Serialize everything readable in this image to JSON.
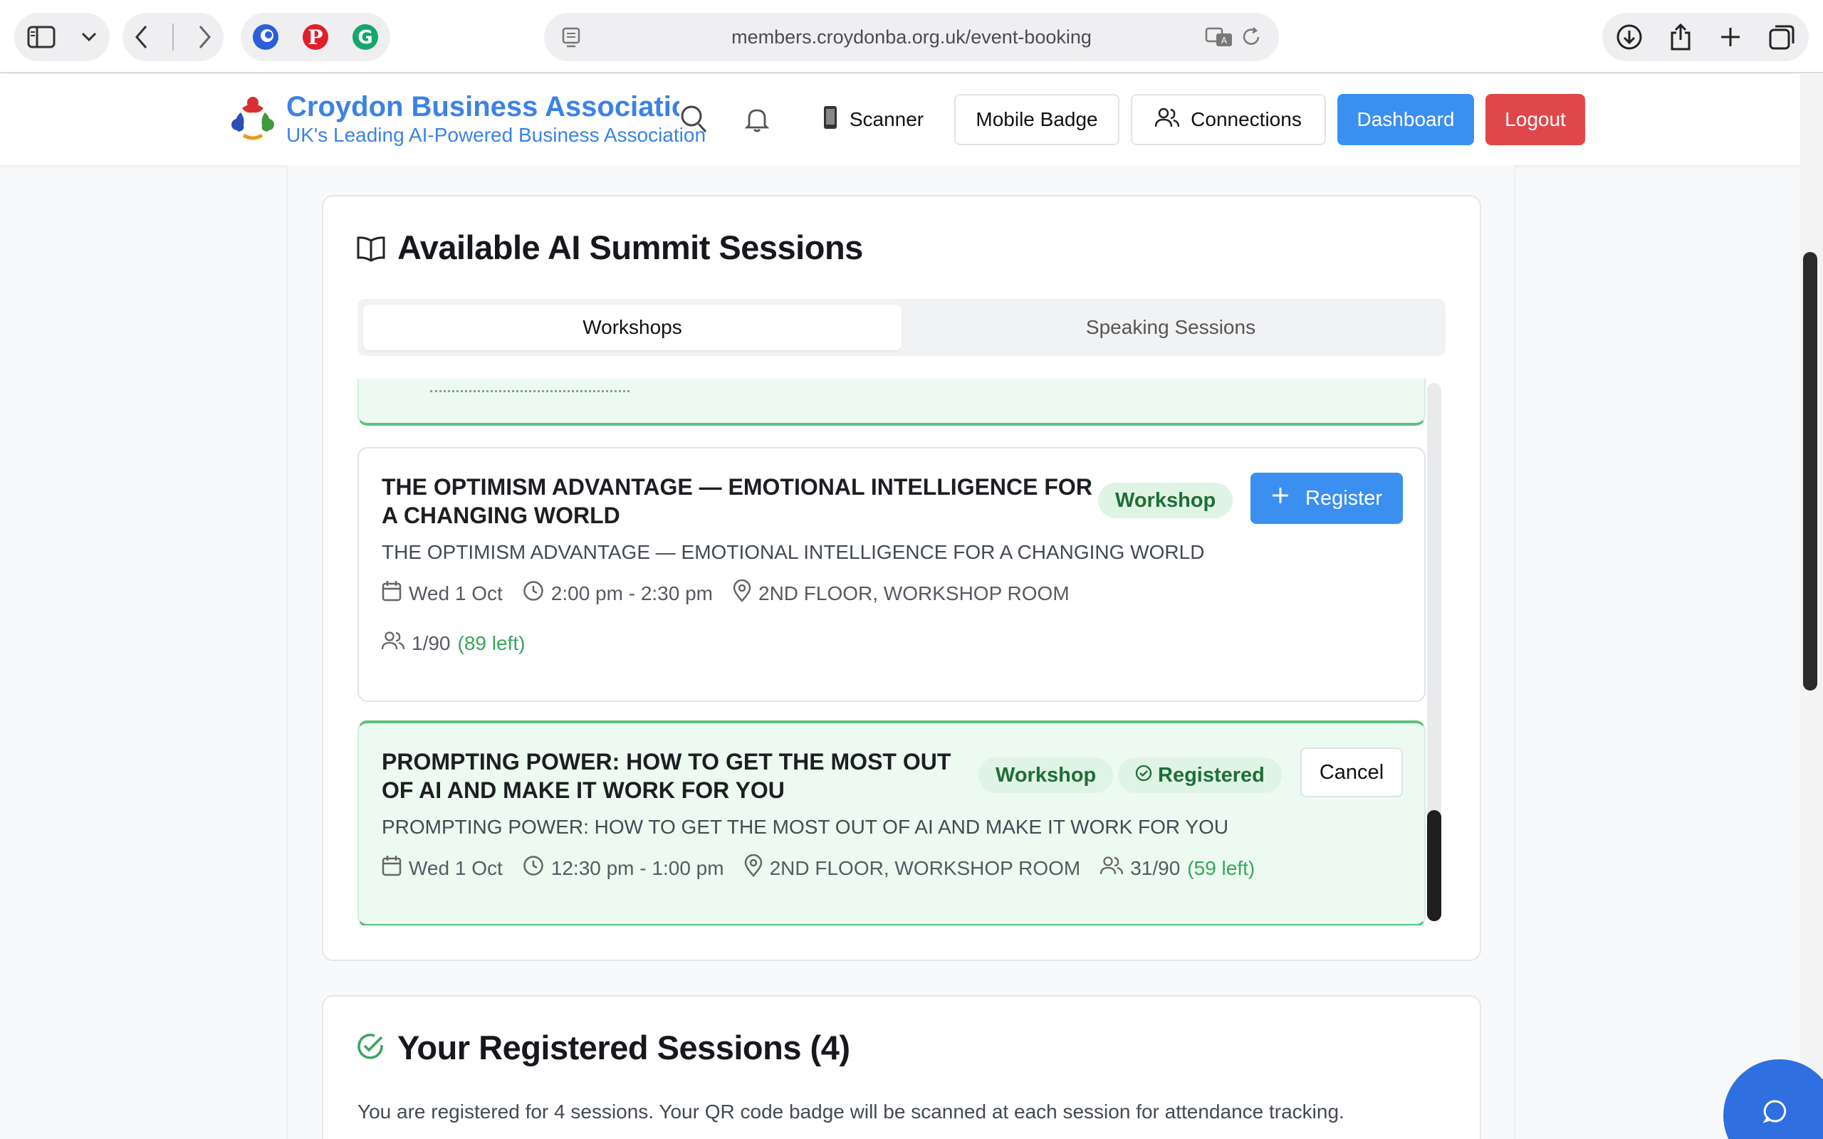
{
  "browser": {
    "url": "members.croydonba.org.uk/event-booking"
  },
  "header": {
    "brand_title": "Croydon Business Association",
    "brand_subtitle": "UK's Leading AI-Powered Business Association",
    "scanner_label": "Scanner",
    "mobile_badge_label": "Mobile Badge",
    "connections_label": "Connections",
    "dashboard_label": "Dashboard",
    "logout_label": "Logout"
  },
  "available": {
    "title": "Available AI Summit Sessions",
    "tabs": [
      {
        "label": "Workshops",
        "active": true
      },
      {
        "label": "Speaking Sessions",
        "active": false
      }
    ],
    "sessions": [
      {
        "title": "THE OPTIMISM ADVANTAGE — EMOTIONAL INTELLIGENCE FOR A CHANGING WORLD",
        "title_line1": "THE OPTIMISM ADVANTAGE — EMOTIONAL INTELLIGENCE FOR",
        "title_line2": "A CHANGING WORLD",
        "description": "THE OPTIMISM ADVANTAGE — EMOTIONAL INTELLIGENCE FOR A CHANGING WORLD",
        "date": "Wed 1 Oct",
        "time": "2:00 pm - 2:30 pm",
        "location": "2ND FLOOR, WORKSHOP ROOM",
        "capacity": "1/90",
        "left": "(89 left)",
        "badge": "Workshop",
        "action": "Register",
        "registered": false
      },
      {
        "title": "PROMPTING POWER: HOW TO GET THE MOST OUT OF AI AND MAKE IT WORK FOR YOU",
        "title_line1": "PROMPTING POWER: HOW TO GET THE MOST OUT",
        "title_line2": "OF AI AND MAKE IT WORK FOR YOU",
        "description": "PROMPTING POWER: HOW TO GET THE MOST OUT OF AI AND MAKE IT WORK FOR YOU",
        "date": "Wed 1 Oct",
        "time": "12:30 pm - 1:00 pm",
        "location": "2ND FLOOR, WORKSHOP ROOM",
        "capacity": "31/90",
        "left": "(59 left)",
        "badge": "Workshop",
        "status_badge": "Registered",
        "action": "Cancel",
        "registered": true
      }
    ]
  },
  "registered": {
    "title": "Your Registered Sessions (4)",
    "description": "You are registered for 4 sessions. Your QR code badge will be scanned at each session for attendance tracking."
  },
  "colors": {
    "brand_blue": "#3b82e6",
    "primary_button": "#3b8ff0",
    "logout_red": "#e0474a",
    "registered_green": "#5cc17a",
    "remaining_green": "#3aa55c",
    "chat_button": "#2f6fe0"
  },
  "icons": [
    "sidebar-icon",
    "chevron-down-icon",
    "back-icon",
    "forward-icon",
    "pinterest-icon",
    "grammarly-icon",
    "translate-icon",
    "reload-icon",
    "download-icon",
    "share-icon",
    "plus-icon",
    "tabs-icon",
    "search-icon",
    "bell-icon",
    "phone-icon",
    "users-icon",
    "book-icon",
    "calendar-icon",
    "clock-icon",
    "map-pin-icon",
    "check-circle-icon",
    "chat-icon"
  ]
}
